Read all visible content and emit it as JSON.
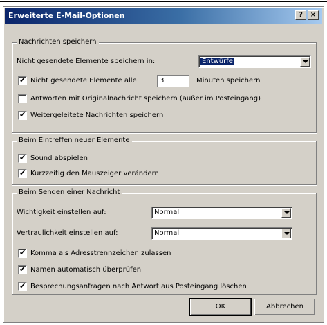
{
  "dialog": {
    "title": "Erweiterte E-Mail-Optionen",
    "help_button": "?",
    "close_button": "×"
  },
  "save": {
    "legend": "Nachrichten speichern",
    "folder_label": "Nicht gesendete Elemente speichern in:",
    "folder_value": "Entwürfe",
    "autosave_label_before": "Nicht gesendete Elemente alle",
    "autosave_minutes": "3",
    "autosave_label_after": "Minuten speichern",
    "autosave_checked": true,
    "replies_label": "Antworten mit Originalnachricht speichern (außer im Posteingang)",
    "replies_checked": false,
    "forwarded_label": "Weitergeleitete Nachrichten speichern",
    "forwarded_checked": true
  },
  "arrival": {
    "legend": "Beim Eintreffen neuer Elemente",
    "sound_label": "Sound abspielen",
    "sound_checked": true,
    "cursor_label": "Kurzzeitig den Mauszeiger verändern",
    "cursor_checked": true
  },
  "sending": {
    "legend": "Beim Senden einer Nachricht",
    "importance_label": "Wichtigkeit einstellen auf:",
    "importance_value": "Normal",
    "sensitivity_label": "Vertraulichkeit einstellen auf:",
    "sensitivity_value": "Normal",
    "comma_label": "Komma als Adresstrennzeichen zulassen",
    "comma_checked": true,
    "names_label": "Namen automatisch überprüfen",
    "names_checked": true,
    "meeting_label": "Besprechungsanfragen nach Antwort aus Posteingang löschen",
    "meeting_checked": true
  },
  "buttons": {
    "ok": "OK",
    "cancel": "Abbrechen"
  },
  "icons": {
    "check": "✔"
  }
}
